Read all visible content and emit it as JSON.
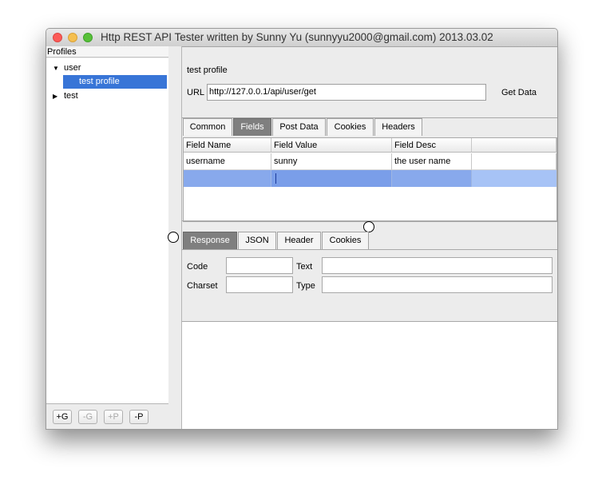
{
  "window": {
    "title": "Http REST API Tester  written by Sunny Yu (sunnyyu2000@gmail.com)  2013.03.02"
  },
  "sidebar": {
    "header": "Profiles",
    "groups": [
      {
        "label": "user",
        "expanded": true,
        "children": [
          {
            "label": "test profile",
            "selected": true
          }
        ]
      },
      {
        "label": "test",
        "expanded": false,
        "children": []
      }
    ],
    "buttons": [
      {
        "label": "+G",
        "enabled": true
      },
      {
        "label": "-G",
        "enabled": false
      },
      {
        "label": "+P",
        "enabled": false
      },
      {
        "label": "-P",
        "enabled": true
      }
    ]
  },
  "request": {
    "profile_name": "test profile",
    "url_label": "URL",
    "url_value": "http://127.0.0.1/api/user/get",
    "get_data_label": "Get Data",
    "tabs": [
      "Common",
      "Fields",
      "Post Data",
      "Cookies",
      "Headers"
    ],
    "active_tab": "Fields",
    "fields_table": {
      "columns": [
        "Field Name",
        "Field Value",
        "Field Desc",
        ""
      ],
      "rows": [
        [
          "username",
          "sunny",
          "the user name",
          ""
        ],
        [
          "",
          "",
          "",
          ""
        ]
      ]
    }
  },
  "response": {
    "tabs": [
      "Response",
      "JSON",
      "Header",
      "Cookies"
    ],
    "active_tab": "Response",
    "code_label": "Code",
    "text_label": "Text",
    "charset_label": "Charset",
    "type_label": "Type",
    "code_value": "",
    "text_value": "",
    "charset_value": "",
    "type_value": ""
  },
  "colors": {
    "selection": "#3875d7",
    "active_tab": "#7f7f7f",
    "selected_row": "#a7c3f6"
  }
}
